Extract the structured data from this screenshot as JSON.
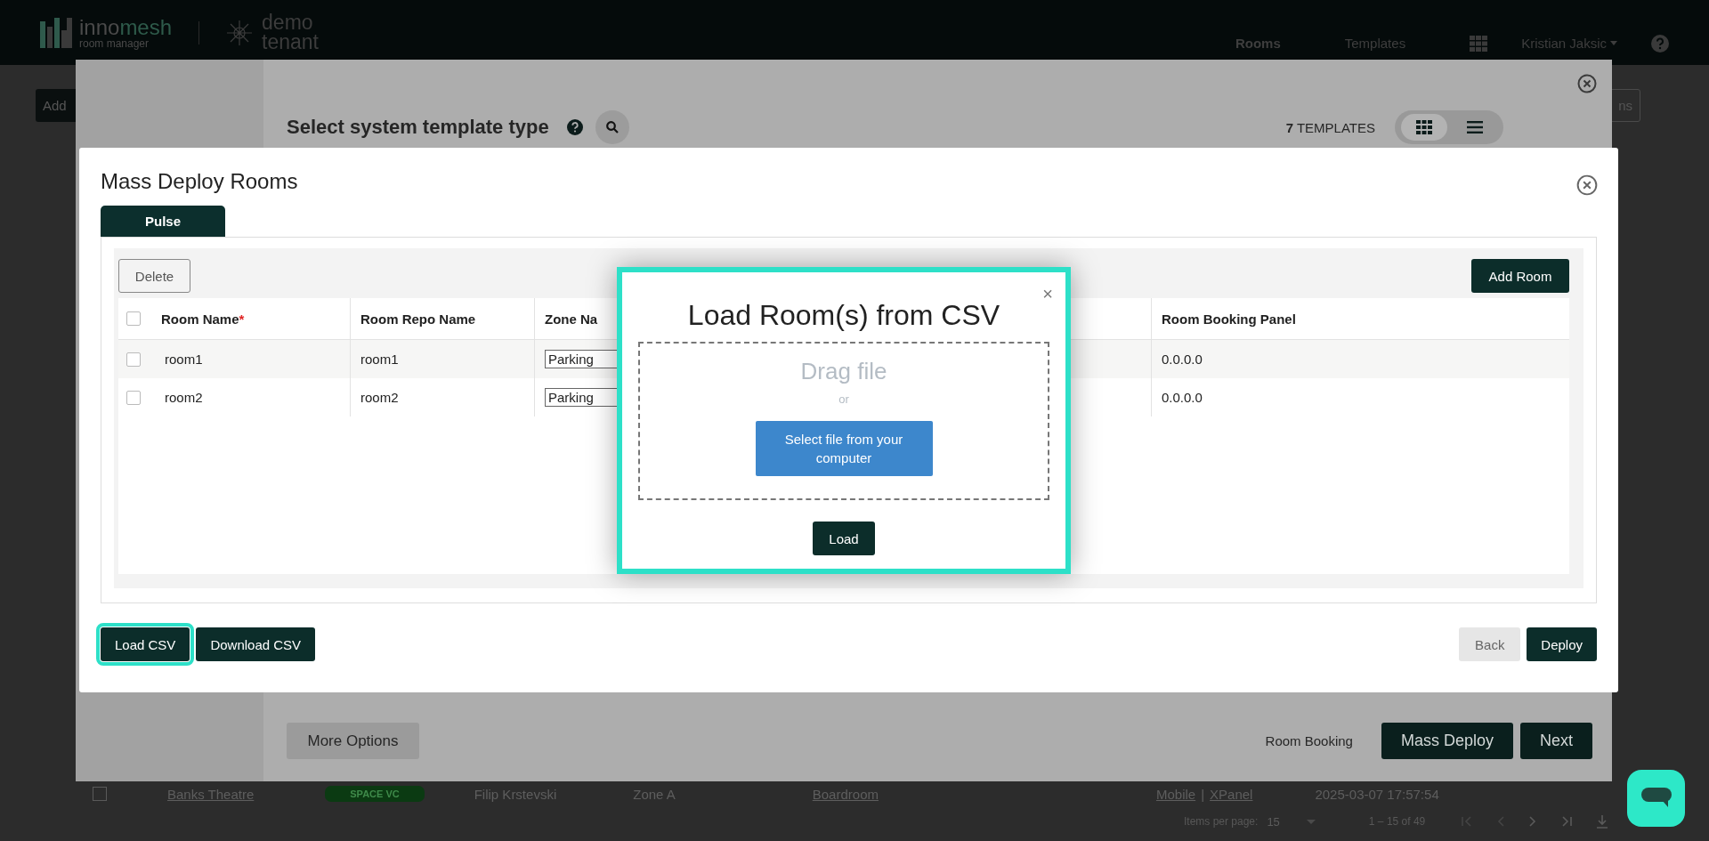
{
  "app": {
    "logo": {
      "first": "inno",
      "second": "mesh",
      "tagline": "room manager"
    },
    "tenant": {
      "line1": "demo",
      "line2": "tenant"
    },
    "nav": [
      {
        "label": "Rooms",
        "selected": true
      },
      {
        "label": "Templates",
        "selected": false
      }
    ],
    "user": "Kristian Jaksic",
    "left_button": "Add",
    "right_button": "ns",
    "row": {
      "checked": false,
      "name": "Banks Theatre",
      "badge": "SPACE VC",
      "owner": "Filip Krstevski",
      "zone": "Zone A",
      "type": "Boardroom",
      "link_a": "Mobile",
      "separator": "|",
      "link_b": "XPanel",
      "date": "2025-03-07 17:57:54"
    },
    "pagination": {
      "label": "Items per page:",
      "value": "15",
      "range": "1 – 15 of 49"
    }
  },
  "template_dialog": {
    "title": "Select system template type",
    "count": "7",
    "count_label": "TEMPLATES",
    "views": [
      {
        "kind": "grid",
        "selected": true
      },
      {
        "kind": "list",
        "selected": false
      }
    ],
    "more_options": "More Options",
    "room_booking": "Room Booking",
    "mass_deploy": "Mass Deploy",
    "next": "Next"
  },
  "mass_deploy_dialog": {
    "title": "Mass Deploy Rooms",
    "tabs": [
      {
        "label": "Pulse",
        "selected": true
      }
    ],
    "delete": "Delete",
    "add_room": "Add Room",
    "all_checked": false,
    "columns": [
      {
        "label": "Room Name",
        "required_mark": "*"
      },
      {
        "label": "Room Repo Name"
      },
      {
        "label": "Zone Na"
      },
      {
        "label": "Room Booking Panel"
      }
    ],
    "rows": [
      {
        "checked": false,
        "name": "room1",
        "repo": "room1",
        "zone": "Parking",
        "panel": "0.0.0.0"
      },
      {
        "checked": false,
        "name": "room2",
        "repo": "room2",
        "zone": "Parking",
        "panel": "0.0.0.0"
      }
    ],
    "load_csv": {
      "label": "Load CSV",
      "highlighted": true
    },
    "download_csv": "Download CSV",
    "back": "Back",
    "deploy": "Deploy"
  },
  "csv_dialog": {
    "highlighted": true,
    "close": "×",
    "title": "Load Room(s) from CSV",
    "drag": "Drag file",
    "or": "or",
    "select": "Select file from your computer",
    "load": "Load"
  }
}
